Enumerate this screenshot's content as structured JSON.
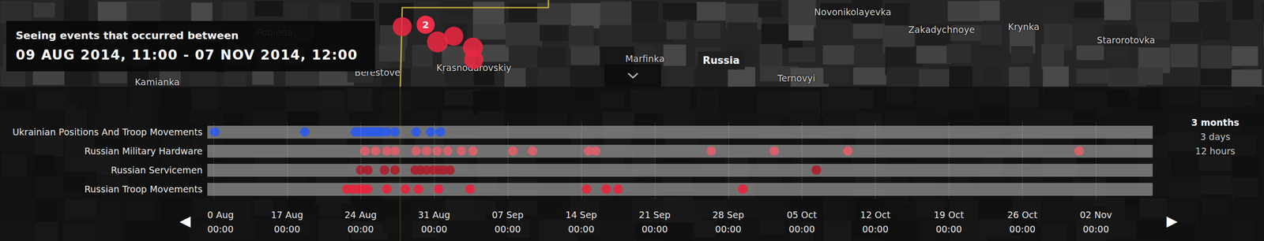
{
  "map": {
    "labels": [
      "Pobieda",
      "Berestove",
      "Krasnodarovskiy",
      "Marfinka",
      "Novonikolayevka",
      "Zakadychnoye",
      "Krynka",
      "Starorotovka",
      "Ternovyi",
      "Kamianka"
    ],
    "markers": [
      {
        "kind": "point"
      },
      {
        "kind": "cluster",
        "count": "2"
      },
      {
        "kind": "point"
      },
      {
        "kind": "point"
      },
      {
        "kind": "point"
      },
      {
        "kind": "point"
      }
    ]
  },
  "info": {
    "title": "Seeing events that occurred between",
    "range": "09 AUG 2014, 11:00 - 07 NOV 2014, 12:00"
  },
  "tooltip": {
    "text": "Russia"
  },
  "timeline": {
    "rows": [
      {
        "label": "Ukrainian Positions And Troop Movements",
        "color": "#2e5be6",
        "days": [
          0.15,
          8.7,
          13.5,
          14.0,
          14.4,
          14.8,
          15.2,
          15.6,
          15.9,
          16.5,
          17.3,
          19.3,
          20.7,
          21.6
        ]
      },
      {
        "label": "Russian Military Hardware",
        "color": "#d9606b",
        "days": [
          14.4,
          15.4,
          16.5,
          17.3,
          19.3,
          20.3,
          21.3,
          22.3,
          23.6,
          24.7,
          28.5,
          30.4,
          35.7,
          36.4,
          47.4,
          53.4,
          60.4,
          82.4
        ]
      },
      {
        "label": "Russian Servicemen",
        "color": "#a8222e",
        "days": [
          14.0,
          14.7,
          16.3,
          17.3,
          19.2,
          19.7,
          20.3,
          20.9,
          21.4,
          21.9,
          22.5,
          57.4
        ]
      },
      {
        "label": "Russian Troop Movements",
        "color": "#e2263e",
        "days": [
          12.7,
          13.3,
          13.9,
          14.2,
          14.7,
          16.5,
          18.3,
          19.5,
          21.4,
          24.4,
          35.5,
          37.4,
          38.5,
          50.4
        ]
      }
    ],
    "ticks": [
      {
        "date": "0 Aug",
        "time": "00:00",
        "day": 0
      },
      {
        "date": "17 Aug",
        "time": "00:00",
        "day": 7
      },
      {
        "date": "24 Aug",
        "time": "00:00",
        "day": 14
      },
      {
        "date": "31 Aug",
        "time": "00:00",
        "day": 21
      },
      {
        "date": "07 Sep",
        "time": "00:00",
        "day": 28
      },
      {
        "date": "14 Sep",
        "time": "00:00",
        "day": 35
      },
      {
        "date": "21 Sep",
        "time": "00:00",
        "day": 42
      },
      {
        "date": "28 Sep",
        "time": "00:00",
        "day": 49
      },
      {
        "date": "05 Oct",
        "time": "00:00",
        "day": 56
      },
      {
        "date": "12 Oct",
        "time": "00:00",
        "day": 63
      },
      {
        "date": "19 Oct",
        "time": "00:00",
        "day": 70
      },
      {
        "date": "26 Oct",
        "time": "00:00",
        "day": 77
      },
      {
        "date": "02 Nov",
        "time": "00:00",
        "day": 84
      }
    ],
    "prev": "◀",
    "next": "▶",
    "zoom": [
      {
        "label": "3 months",
        "selected": true
      },
      {
        "label": "3 days",
        "selected": false
      },
      {
        "label": "12 hours",
        "selected": false
      }
    ]
  }
}
